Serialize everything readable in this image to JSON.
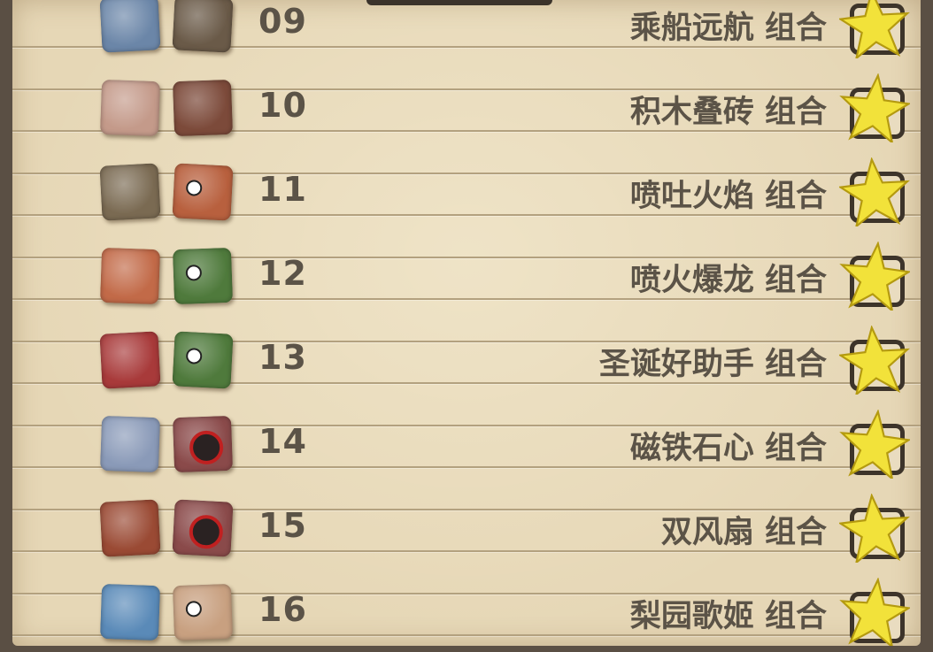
{
  "combos": [
    {
      "level": "09",
      "title": "乘船远航 组合",
      "icon_a": "pirate-icon",
      "icon_b": "cart-icon",
      "color_a": "#6b86a8",
      "color_b": "#6a5a48"
    },
    {
      "level": "10",
      "title": "积木叠砖 组合",
      "icon_a": "blocks-icon",
      "icon_b": "brick-icon",
      "color_a": "#c49a8a",
      "color_b": "#7c4a3a"
    },
    {
      "level": "11",
      "title": "喷吐火焰 组合",
      "icon_a": "horseshoe-icon",
      "icon_b": "dragon-icon",
      "color_a": "#7a6a52",
      "color_b": "#b8603e"
    },
    {
      "level": "12",
      "title": "喷火爆龙 组合",
      "icon_a": "dragon-icon",
      "icon_b": "pink-monster-icon",
      "color_a": "#c26a48",
      "color_b": "#4f7a3c"
    },
    {
      "level": "13",
      "title": "圣诞好助手 组合",
      "icon_a": "reindeer-icon",
      "icon_b": "pink-monster-icon",
      "color_a": "#a83a3a",
      "color_b": "#4f7a3c"
    },
    {
      "level": "14",
      "title": "磁铁石心 组合",
      "icon_a": "magnet-icon",
      "icon_b": "stone-heart-icon",
      "color_a": "#8a9ab8",
      "color_b": "#8a4a4a"
    },
    {
      "level": "15",
      "title": "双风扇 组合",
      "icon_a": "fan-icon",
      "icon_b": "stone-heart-icon",
      "color_a": "#9a4a34",
      "color_b": "#8a4a4a"
    },
    {
      "level": "16",
      "title": "梨园歌姬 组合",
      "icon_a": "pear-tree-icon",
      "icon_b": "viking-icon",
      "color_a": "#5a8ab8",
      "color_b": "#c8a080"
    }
  ],
  "colors": {
    "paper": "#e6d7b6",
    "text": "#5b5347",
    "star": "#f2e23a",
    "star_outline": "#b49a10",
    "frame": "#5a4f44"
  }
}
